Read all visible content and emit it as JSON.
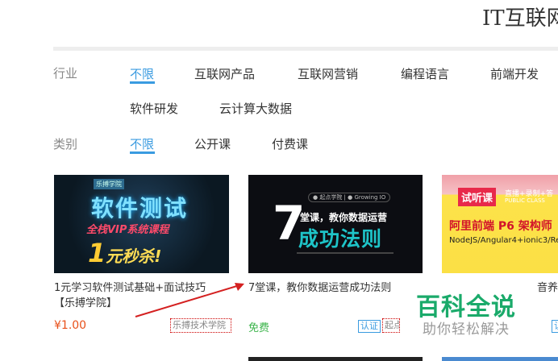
{
  "header": {
    "title": "IT互联网"
  },
  "filters": {
    "industry": {
      "label": "行业",
      "options": [
        "不限",
        "互联网产品",
        "互联网营销",
        "编程语言",
        "前端开发",
        "软件研发",
        "云计算大数据"
      ]
    },
    "category": {
      "label": "类别",
      "options": [
        "不限",
        "公开课",
        "付费课"
      ]
    }
  },
  "courses": [
    {
      "title_line1": "1元学习软件测试基础+面试技巧",
      "title_line2": "【乐搏学院】",
      "price": "¥1.00",
      "provider": "乐搏技术学院",
      "thumb": {
        "badge": "乐搏学院",
        "headline": "软件测试",
        "subline": "全栈VIP系统课程",
        "promo_num": "1",
        "promo_text": "元秒杀!"
      }
    },
    {
      "title_line1": "7堂课，教你数据运营成功法则",
      "price": "免费",
      "cert": "认证",
      "provider": "起点",
      "thumb": {
        "logos": "● 起点学院  |  ● Growing IO",
        "big_num": "7",
        "line1": "堂课，教你数据运营",
        "line2": "成功法则"
      }
    },
    {
      "title_suffix": "音养",
      "cert": "认",
      "thumb": {
        "badge": "试听课",
        "live": "直播+录制+答",
        "public": "PUBLIC CLASS",
        "headline": "阿里前端 P6 架构师",
        "tech": "NodeJS/Angular4+ionic3/Re"
      }
    }
  ],
  "watermark": {
    "title": "百科全说",
    "subtitle": "助你轻松解决"
  },
  "colors": {
    "accent": "#3a9be0",
    "price_red": "#e8501a",
    "free_green": "#3cb44b",
    "annotation_red": "#d42020"
  }
}
